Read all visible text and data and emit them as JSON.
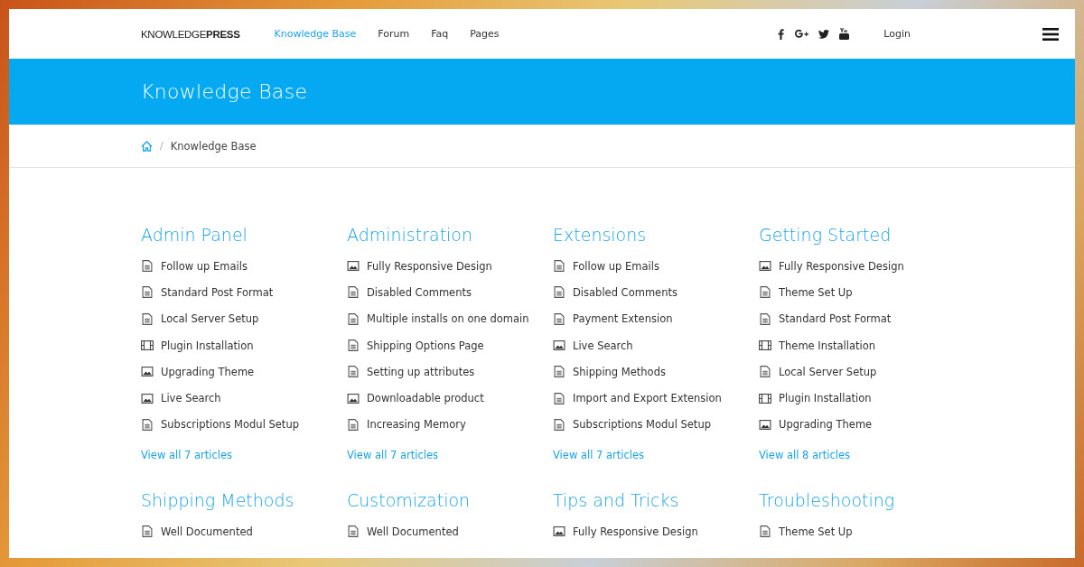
{
  "header": {
    "logo": "KNOWLEDGE**PRESS**",
    "nav": [
      {
        "label": "Knowledge Base",
        "selected": true
      },
      {
        "label": "Forum",
        "selected": false
      },
      {
        "label": "Faq",
        "selected": false
      },
      {
        "label": "Pages",
        "selected": false
      }
    ],
    "social": [
      {
        "kind": "facebook"
      },
      {
        "kind": "googleplus"
      },
      {
        "kind": "twitter"
      },
      {
        "kind": "youtube"
      }
    ],
    "login": "Login"
  },
  "banner": {
    "title": "Knowledge Base"
  },
  "breadcrumb": {
    "separator": "/",
    "current": "Knowledge Base"
  },
  "sections": [
    {
      "title": "Admin Panel",
      "articles": [
        {
          "title": "Follow up Emails",
          "kind": "doc"
        },
        {
          "title": "Standard Post Format",
          "kind": "doc"
        },
        {
          "title": "Local Server Setup",
          "kind": "doc"
        },
        {
          "title": "Plugin Installation",
          "kind": "video"
        },
        {
          "title": "Upgrading Theme",
          "kind": "image"
        },
        {
          "title": "Live Search",
          "kind": "image"
        },
        {
          "title": "Subscriptions Modul Setup",
          "kind": "doc"
        }
      ],
      "view_all": "View all 7 articles"
    },
    {
      "title": "Administration",
      "articles": [
        {
          "title": "Fully Responsive Design",
          "kind": "image"
        },
        {
          "title": "Disabled Comments",
          "kind": "doc"
        },
        {
          "title": "Multiple installs on one domain",
          "kind": "doc"
        },
        {
          "title": "Shipping Options Page",
          "kind": "doc"
        },
        {
          "title": "Setting up attributes",
          "kind": "doc"
        },
        {
          "title": "Downloadable product",
          "kind": "image"
        },
        {
          "title": "Increasing Memory",
          "kind": "doc"
        }
      ],
      "view_all": "View all 7 articles"
    },
    {
      "title": "Extensions",
      "articles": [
        {
          "title": "Follow up Emails",
          "kind": "doc"
        },
        {
          "title": "Disabled Comments",
          "kind": "doc"
        },
        {
          "title": "Payment Extension",
          "kind": "doc"
        },
        {
          "title": "Live Search",
          "kind": "image"
        },
        {
          "title": "Shipping Methods",
          "kind": "doc"
        },
        {
          "title": "Import and Export Extension",
          "kind": "doc"
        },
        {
          "title": "Subscriptions Modul Setup",
          "kind": "doc"
        }
      ],
      "view_all": "View all 7 articles"
    },
    {
      "title": "Getting Started",
      "articles": [
        {
          "title": "Fully Responsive Design",
          "kind": "image"
        },
        {
          "title": "Theme Set Up",
          "kind": "doc"
        },
        {
          "title": "Standard Post Format",
          "kind": "doc"
        },
        {
          "title": "Theme Installation",
          "kind": "video"
        },
        {
          "title": "Local Server Setup",
          "kind": "doc"
        },
        {
          "title": "Plugin Installation",
          "kind": "video"
        },
        {
          "title": "Upgrading Theme",
          "kind": "image"
        }
      ],
      "view_all": "View all 8 articles"
    },
    {
      "title": "Shipping Methods",
      "articles": [
        {
          "title": "Well Documented",
          "kind": "doc"
        }
      ]
    },
    {
      "title": "Customization",
      "articles": [
        {
          "title": "Well Documented",
          "kind": "doc"
        }
      ]
    },
    {
      "title": "Tips and Tricks",
      "articles": [
        {
          "title": "Fully Responsive Design",
          "kind": "image"
        }
      ]
    },
    {
      "title": "Troubleshooting",
      "articles": [
        {
          "title": "Theme Set Up",
          "kind": "doc"
        }
      ]
    }
  ]
}
